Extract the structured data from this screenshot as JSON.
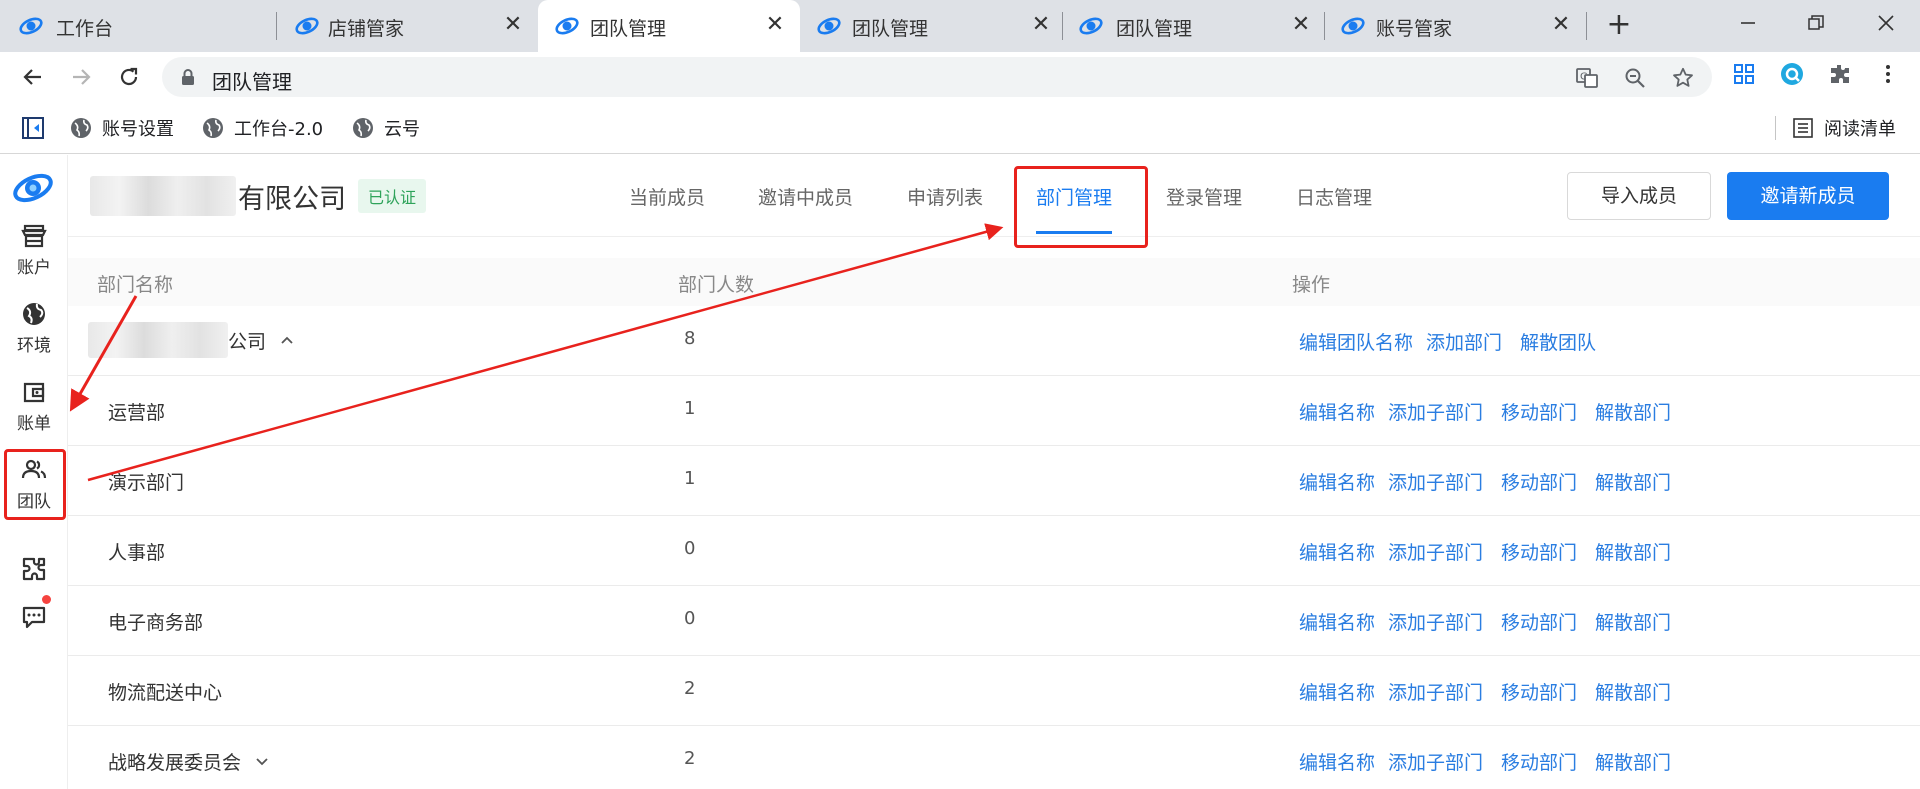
{
  "browser": {
    "tabs": [
      {
        "title": "工作台",
        "active": false,
        "closable": false
      },
      {
        "title": "店铺管家",
        "active": false,
        "closable": true
      },
      {
        "title": "团队管理",
        "active": true,
        "closable": true
      },
      {
        "title": "团队管理",
        "active": false,
        "closable": true
      },
      {
        "title": "团队管理",
        "active": false,
        "closable": true
      },
      {
        "title": "账号管家",
        "active": false,
        "closable": true
      }
    ],
    "close_glyph": "✕",
    "new_tab_glyph": "+",
    "address": "团队管理",
    "bookmarks": [
      "账号设置",
      "工作台-2.0",
      "云号"
    ],
    "reading_list": "阅读清单",
    "accent": "#1a7cf0"
  },
  "sidebar": {
    "items": [
      {
        "label": "账户",
        "icon": "store-icon"
      },
      {
        "label": "环境",
        "icon": "globe-icon"
      },
      {
        "label": "账单",
        "icon": "wallet-icon"
      },
      {
        "label": "团队",
        "icon": "team-icon",
        "highlighted": true
      },
      {
        "label": "",
        "icon": "plugin-icon"
      },
      {
        "label": "",
        "icon": "message-icon",
        "has_notification": true
      }
    ]
  },
  "header": {
    "company_suffix": "有限公司",
    "verified_badge": "已认证",
    "tabs": [
      "当前成员",
      "邀请中成员",
      "申请列表",
      "部门管理",
      "登录管理",
      "日志管理"
    ],
    "active_tab": "部门管理",
    "import_button": "导入成员",
    "invite_button": "邀请新成员"
  },
  "table": {
    "columns": [
      "部门名称",
      "部门人数",
      "操作"
    ],
    "root": {
      "name_suffix": "公司",
      "count": "8",
      "actions": [
        "编辑团队名称",
        "添加部门",
        "解散团队"
      ]
    },
    "rows": [
      {
        "name": "运营部",
        "count": "1"
      },
      {
        "name": "演示部门",
        "count": "1"
      },
      {
        "name": "人事部",
        "count": "0"
      },
      {
        "name": "电子商务部",
        "count": "0"
      },
      {
        "name": "物流配送中心",
        "count": "2"
      },
      {
        "name": "战略发展委员会",
        "count": "2",
        "expandable": true
      }
    ],
    "row_actions": [
      "编辑名称",
      "添加子部门",
      "移动部门",
      "解散部门"
    ]
  }
}
